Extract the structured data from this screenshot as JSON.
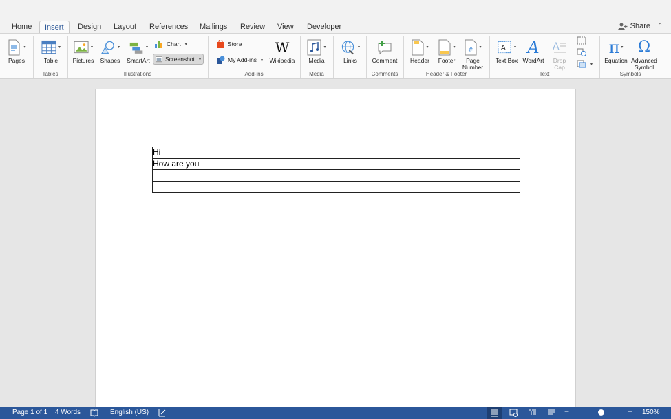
{
  "ribbon": {
    "tabs": [
      "Home",
      "Insert",
      "Design",
      "Layout",
      "References",
      "Mailings",
      "Review",
      "View",
      "Developer"
    ],
    "active_tab": "Insert",
    "share_label": "Share",
    "groups": {
      "tables": "Tables",
      "illustrations": "Illustrations",
      "addins": "Add-ins",
      "media": "Media",
      "comments": "Comments",
      "header_footer": "Header & Footer",
      "text": "Text",
      "symbols": "Symbols"
    },
    "buttons": {
      "pages": "Pages",
      "table": "Table",
      "pictures": "Pictures",
      "shapes": "Shapes",
      "smartart": "SmartArt",
      "chart": "Chart",
      "screenshot": "Screenshot",
      "store": "Store",
      "my_addins": "My Add-ins",
      "wikipedia": "Wikipedia",
      "media": "Media",
      "links": "Links",
      "comment": "Comment",
      "header": "Header",
      "footer": "Footer",
      "page_number_1": "Page",
      "page_number_2": "Number",
      "text_box": "Text Box",
      "wordart": "WordArt",
      "drop_cap_1": "Drop",
      "drop_cap_2": "Cap",
      "equation": "Equation",
      "advanced_symbol_1": "Advanced",
      "advanced_symbol_2": "Symbol"
    }
  },
  "document": {
    "table_rows": [
      "Hi",
      "How are you",
      "",
      ""
    ]
  },
  "status_bar": {
    "page": "Page 1 of 1",
    "words": "4 Words",
    "language": "English (US)",
    "zoom": "150%",
    "zoom_fraction": 0.55
  },
  "colors": {
    "accent": "#2b579a",
    "active_tab_text": "#2b5797"
  }
}
